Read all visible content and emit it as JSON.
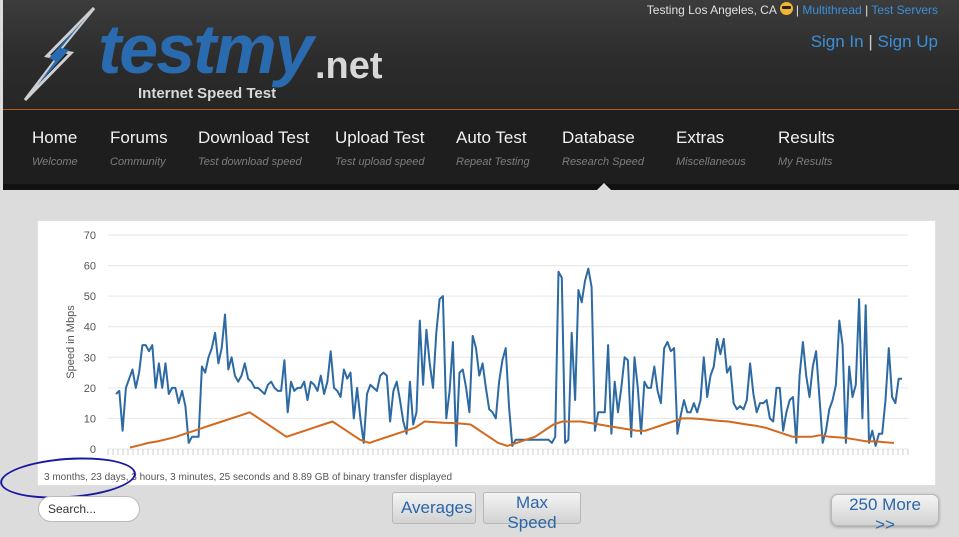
{
  "header": {
    "logo_main": "testmy",
    "logo_ext": ".net",
    "logo_sub": "Internet Speed Test",
    "testing_location": "Testing Los Angeles, CA",
    "multithread_link": "Multithread",
    "test_servers_link": "Test Servers",
    "sign_in": "Sign In",
    "sign_up": "Sign Up",
    "separator": "|"
  },
  "nav": {
    "items": [
      {
        "title": "Home",
        "sub": "Welcome"
      },
      {
        "title": "Forums",
        "sub": "Community"
      },
      {
        "title": "Download Test",
        "sub": "Test download speed"
      },
      {
        "title": "Upload Test",
        "sub": "Test upload speed"
      },
      {
        "title": "Auto Test",
        "sub": "Repeat Testing"
      },
      {
        "title": "Database",
        "sub": "Research Speed"
      },
      {
        "title": "Extras",
        "sub": "Miscellaneous"
      },
      {
        "title": "Results",
        "sub": "My Results"
      }
    ],
    "active": "Database"
  },
  "chart_data": {
    "type": "line",
    "ylabel": "Speed in Mbps",
    "ylim": [
      0,
      70
    ],
    "yticks": [
      0,
      10,
      20,
      30,
      40,
      50,
      60,
      70
    ],
    "grid": true,
    "series": [
      {
        "color": "#2d6aa3",
        "values": [
          18,
          19,
          6,
          20,
          23,
          26,
          20,
          25,
          34,
          34,
          32,
          34,
          20,
          28,
          20,
          28,
          18,
          20,
          20,
          15,
          19,
          14,
          2,
          4,
          4,
          4,
          27,
          25,
          30,
          33,
          38,
          28,
          33,
          44,
          26,
          30,
          24,
          22,
          24,
          28,
          23,
          22,
          20,
          20,
          19,
          18,
          21,
          22,
          20,
          19,
          19,
          29,
          12,
          22,
          19,
          20,
          20,
          22,
          16,
          22,
          21,
          19,
          24,
          18,
          22,
          32,
          20,
          19,
          17,
          26,
          23,
          25,
          10,
          20,
          10,
          2,
          18,
          21,
          20,
          19,
          24,
          25,
          24,
          9,
          19,
          22,
          16,
          9,
          5,
          22,
          8,
          12,
          42,
          21,
          39,
          28,
          20,
          38,
          49,
          50,
          10,
          19,
          35,
          1,
          25,
          26,
          20,
          12,
          37,
          33,
          24,
          28,
          20,
          13,
          12,
          10,
          22,
          29,
          33,
          14,
          1,
          3,
          3,
          3,
          3,
          3,
          3,
          3,
          3,
          3,
          3,
          3,
          2,
          4,
          58,
          56,
          2,
          3,
          38,
          16,
          52,
          48,
          55,
          59,
          53,
          6,
          12,
          12,
          12,
          34,
          5,
          22,
          12,
          20,
          30,
          29,
          4,
          30,
          20,
          5,
          22,
          20,
          20,
          27,
          19,
          15,
          33,
          35,
          32,
          33,
          5,
          11,
          16,
          12,
          12,
          15,
          12,
          16,
          30,
          17,
          24,
          27,
          36,
          31,
          36,
          25,
          27,
          15,
          13,
          14,
          13,
          16,
          28,
          18,
          12,
          15,
          15,
          16,
          10,
          9,
          20,
          20,
          6,
          12,
          16,
          17,
          2,
          24,
          35,
          24,
          17,
          27,
          32,
          17,
          2,
          6,
          13,
          16,
          21,
          42,
          34,
          2,
          27,
          17,
          21,
          49,
          10,
          47,
          2,
          6,
          1,
          5,
          5,
          16,
          33,
          17,
          15,
          23,
          23
        ]
      },
      {
        "color": "#d2691e",
        "values": [
          0.5,
          1.2,
          2,
          2.5,
          3.2,
          4,
          5,
          6,
          7,
          8,
          9,
          10,
          11,
          12,
          10,
          8,
          6,
          4,
          5,
          6,
          7,
          8,
          9,
          7,
          5,
          3,
          2,
          3,
          4,
          5,
          6,
          7,
          9,
          8.8,
          8.6,
          8.5,
          8.3,
          8,
          6,
          4,
          2,
          1,
          2,
          3,
          4,
          6,
          8,
          9,
          9,
          9,
          8.5,
          8,
          7.5,
          7,
          6.5,
          6,
          6,
          7,
          8,
          9,
          10,
          10,
          9.8,
          9.5,
          9.2,
          9,
          8.5,
          8,
          7.6,
          7,
          6,
          5,
          4,
          4,
          4,
          4.5,
          4,
          3.8,
          3.5,
          3,
          2.5,
          2.5,
          2.2,
          2
        ]
      }
    ]
  },
  "footnote": "3 months, 23 days, 3 hours, 3 minutes, 25 seconds and 8.89 GB of binary transfer displayed",
  "controls": {
    "search_placeholder": "Search...",
    "averages": "Averages",
    "max_speed": "Max Speed",
    "more": "250 More >>"
  }
}
